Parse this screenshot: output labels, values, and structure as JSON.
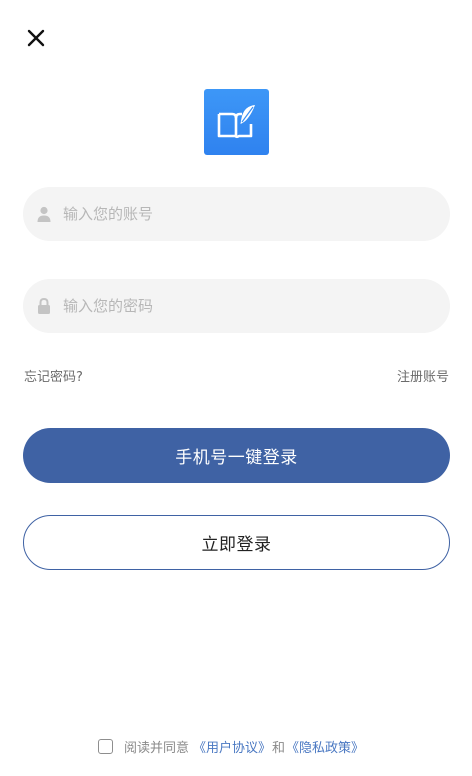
{
  "header": {
    "close_icon": "close-icon"
  },
  "logo": {
    "icon": "book-quill-icon",
    "background": "#3a8ff4"
  },
  "form": {
    "account_placeholder": "输入您的账号",
    "account_icon": "user-icon",
    "password_placeholder": "输入您的密码",
    "password_icon": "lock-icon"
  },
  "links": {
    "forgot_password": "忘记密码?",
    "register": "注册账号"
  },
  "buttons": {
    "phone_login": "手机号一键登录",
    "login_now": "立即登录"
  },
  "agreement": {
    "prefix": "阅读并同意",
    "user_agreement": "《用户协议》",
    "and": "和",
    "privacy_policy": "《隐私政策》",
    "checked": false
  },
  "colors": {
    "primary": "#3f62a4",
    "link": "#4a78c2",
    "input_bg": "#f4f4f4"
  }
}
